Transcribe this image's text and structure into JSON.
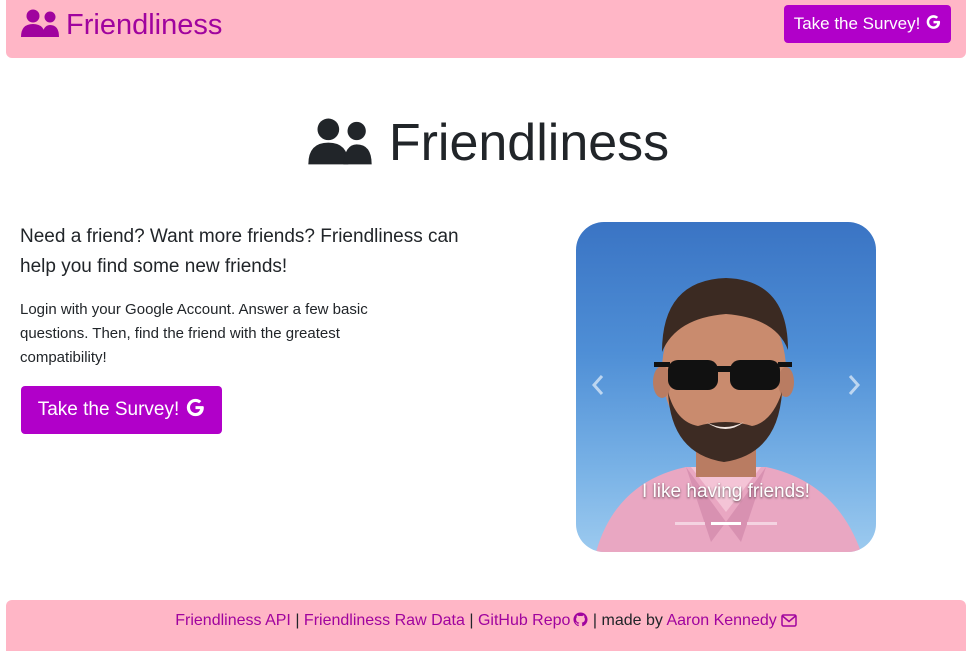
{
  "navbar": {
    "brand": "Friendliness",
    "survey_button": "Take the Survey!",
    "brand_icon": "users-icon",
    "button_icon": "google-icon"
  },
  "hero": {
    "title": "Friendliness",
    "icon": "users-icon"
  },
  "intro": {
    "lead": "Need a friend? Want more friends? Friendliness can help you find some new friends!",
    "body": "Login with your Google Account. Answer a few basic questions. Then, find the friend with the greatest compatibility!",
    "survey_button": "Take the Survey!"
  },
  "carousel": {
    "caption": "I like having friends!",
    "slide_count": 3,
    "active_index": 1
  },
  "footer": {
    "api_link": "Friendliness API",
    "raw_data_link": "Friendliness Raw Data",
    "github_link": "GitHub Repo",
    "made_by": "made by",
    "author_link": "Aaron Kennedy",
    "separator": "|"
  },
  "colors": {
    "accent": "#b100c9",
    "brand_text": "#a0039e",
    "bar_background": "#ffb6c6",
    "text": "#212529"
  }
}
